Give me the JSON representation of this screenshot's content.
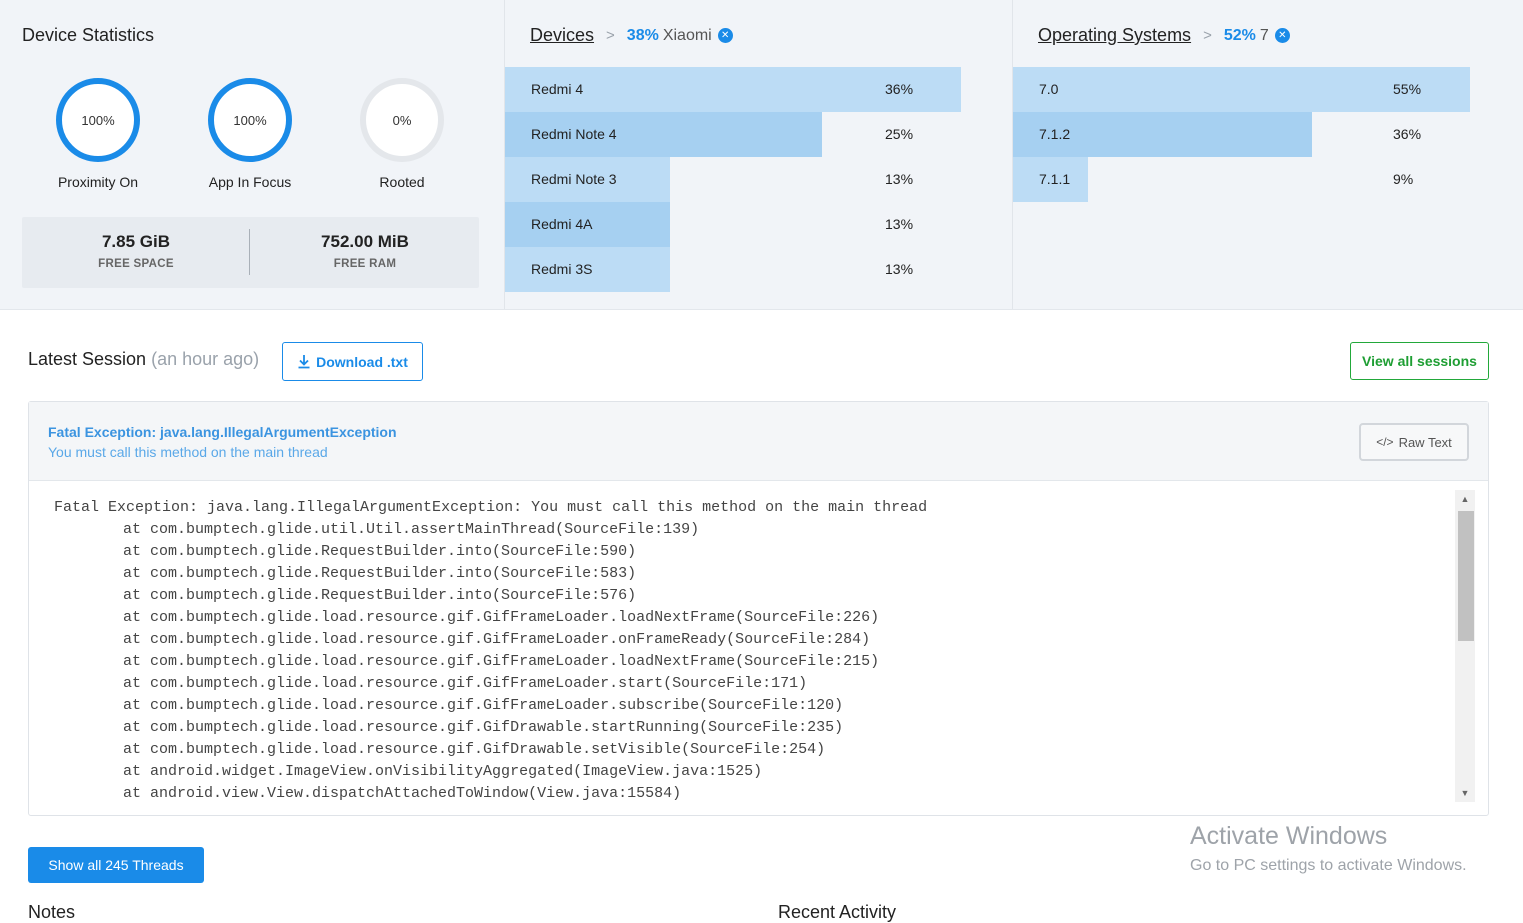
{
  "device_statistics": {
    "title": "Device Statistics",
    "gauges": [
      {
        "value": "100%",
        "label": "Proximity On",
        "fill_percent": 100
      },
      {
        "value": "100%",
        "label": "App In Focus",
        "fill_percent": 100
      },
      {
        "value": "0%",
        "label": "Rooted",
        "fill_percent": 0
      }
    ],
    "free_space": {
      "value": "7.85 GiB",
      "label": "FREE SPACE"
    },
    "free_ram": {
      "value": "752.00 MiB",
      "label": "FREE RAM"
    }
  },
  "devices": {
    "title": "Devices",
    "separator": ">",
    "filter_percent": "38%",
    "filter_value": "Xiaomi",
    "rows": [
      {
        "name": "Redmi 4",
        "percent": "36%",
        "share": 36
      },
      {
        "name": "Redmi Note 4",
        "percent": "25%",
        "share": 25
      },
      {
        "name": "Redmi Note 3",
        "percent": "13%",
        "share": 13
      },
      {
        "name": "Redmi 4A",
        "percent": "13%",
        "share": 13
      },
      {
        "name": "Redmi 3S",
        "percent": "13%",
        "share": 13
      }
    ]
  },
  "operating_systems": {
    "title": "Operating Systems",
    "separator": ">",
    "filter_percent": "52%",
    "filter_value": "7",
    "rows": [
      {
        "name": "7.0",
        "percent": "55%",
        "share": 55
      },
      {
        "name": "7.1.2",
        "percent": "36%",
        "share": 36
      },
      {
        "name": "7.1.1",
        "percent": "9%",
        "share": 9
      }
    ]
  },
  "session": {
    "title": "Latest Session",
    "time_ago": "(an hour ago)",
    "download_label": "Download .txt",
    "view_all_label": "View all sessions",
    "exception_title": "Fatal Exception: java.lang.IllegalArgumentException",
    "exception_message": "You must call this method on the main thread",
    "raw_text_label": "Raw Text",
    "stack_trace": [
      "Fatal Exception: java.lang.IllegalArgumentException: You must call this method on the main thread",
      "at com.bumptech.glide.util.Util.assertMainThread(SourceFile:139)",
      "at com.bumptech.glide.RequestBuilder.into(SourceFile:590)",
      "at com.bumptech.glide.RequestBuilder.into(SourceFile:583)",
      "at com.bumptech.glide.RequestBuilder.into(SourceFile:576)",
      "at com.bumptech.glide.load.resource.gif.GifFrameLoader.loadNextFrame(SourceFile:226)",
      "at com.bumptech.glide.load.resource.gif.GifFrameLoader.onFrameReady(SourceFile:284)",
      "at com.bumptech.glide.load.resource.gif.GifFrameLoader.loadNextFrame(SourceFile:215)",
      "at com.bumptech.glide.load.resource.gif.GifFrameLoader.start(SourceFile:171)",
      "at com.bumptech.glide.load.resource.gif.GifFrameLoader.subscribe(SourceFile:120)",
      "at com.bumptech.glide.load.resource.gif.GifDrawable.startRunning(SourceFile:235)",
      "at com.bumptech.glide.load.resource.gif.GifDrawable.setVisible(SourceFile:254)",
      "at android.widget.ImageView.onVisibilityAggregated(ImageView.java:1525)",
      "at android.view.View.dispatchAttachedToWindow(View.java:15584)"
    ],
    "threads_button_label": "Show all 245 Threads"
  },
  "watermark": {
    "line1": "Activate Windows",
    "line2": "Go to PC settings to activate Windows."
  },
  "sections": {
    "notes": "Notes",
    "recent_activity": "Recent Activity"
  },
  "colors": {
    "accent": "#1a8be8",
    "success": "#22a83a",
    "bar_light": "#bcdcf5",
    "bar_dark": "#a6d0f1"
  }
}
